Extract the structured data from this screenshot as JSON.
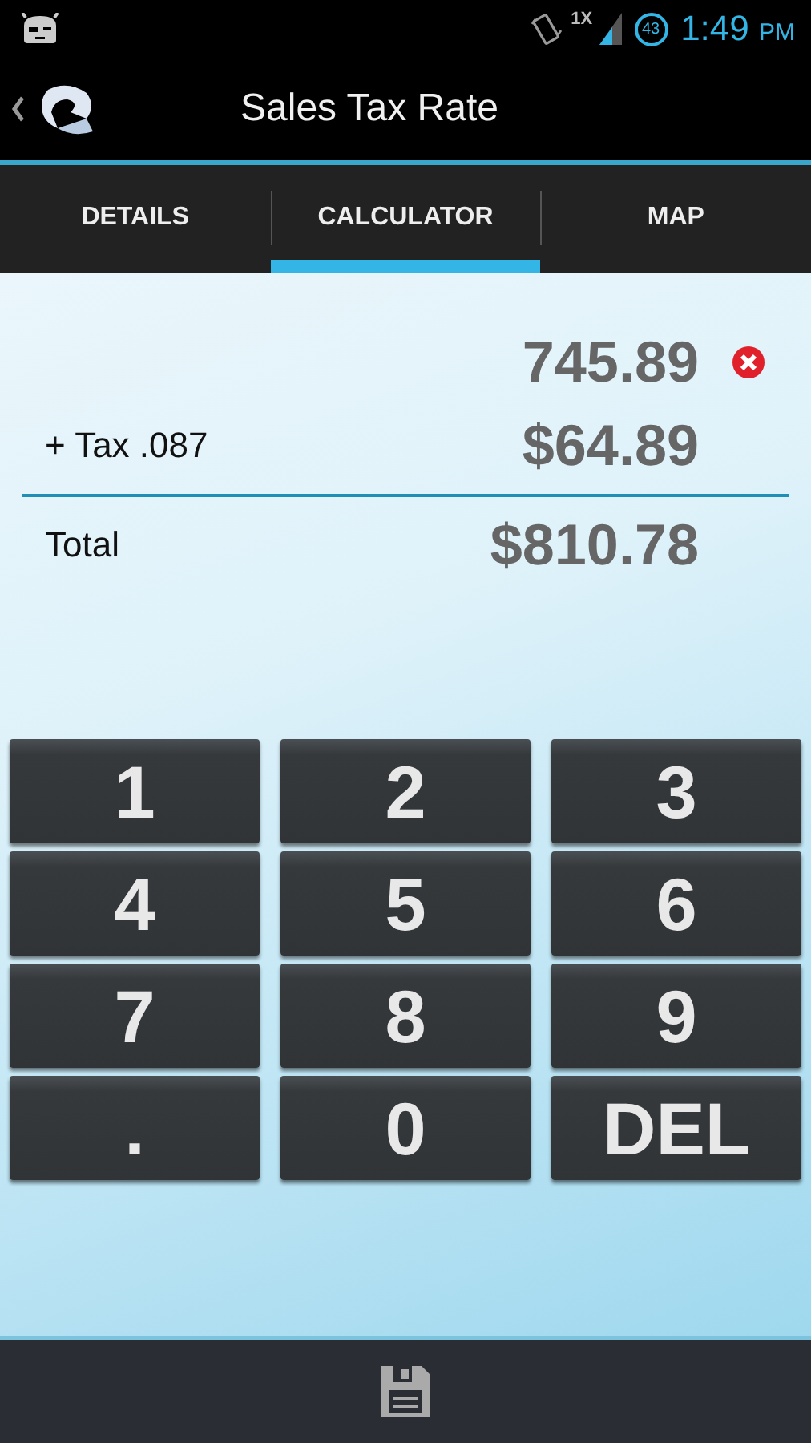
{
  "status_bar": {
    "network": "1X",
    "battery": "43",
    "time": "1:49",
    "period": "PM"
  },
  "action_bar": {
    "title": "Sales Tax Rate"
  },
  "tabs": [
    {
      "label": "DETAILS",
      "selected": false
    },
    {
      "label": "CALCULATOR",
      "selected": true
    },
    {
      "label": "MAP",
      "selected": false
    }
  ],
  "calculator": {
    "amount": "745.89",
    "tax_label": "+ Tax .087",
    "tax_amount": "$64.89",
    "total_label": "Total",
    "total": "$810.78"
  },
  "keys": [
    "1",
    "2",
    "3",
    "4",
    "5",
    "6",
    "7",
    "8",
    "9",
    ".",
    "0",
    "DEL"
  ]
}
